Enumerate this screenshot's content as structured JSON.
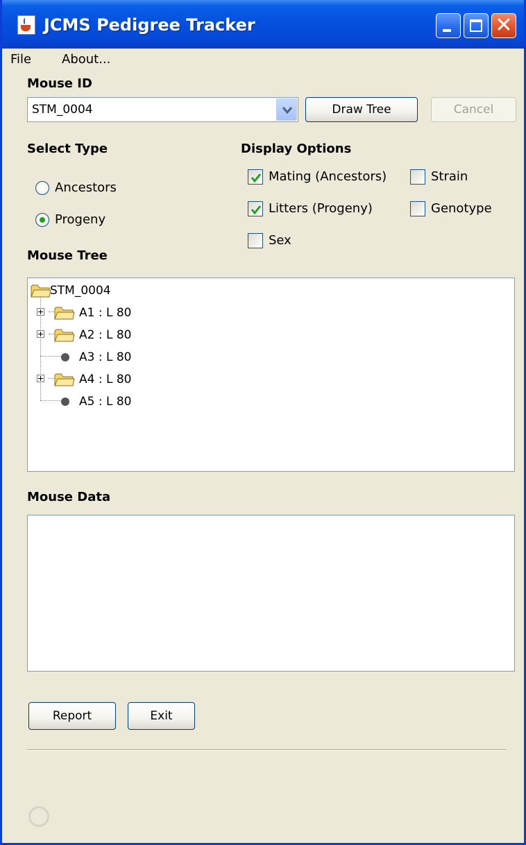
{
  "window": {
    "title": "JCMS Pedigree Tracker",
    "accent": "#0a5fe6"
  },
  "menubar": {
    "items": [
      {
        "label": "File"
      },
      {
        "label": "About..."
      }
    ]
  },
  "mouse_id": {
    "label": "Mouse ID",
    "value": "STM_0004",
    "draw_tree_label": "Draw Tree",
    "cancel_label": "Cancel"
  },
  "select_type": {
    "label": "Select Type",
    "options": [
      {
        "label": "Ancestors",
        "selected": false
      },
      {
        "label": "Progeny",
        "selected": true
      }
    ]
  },
  "display_options": {
    "label": "Display Options",
    "items": [
      {
        "label": "Mating (Ancestors)",
        "checked": true
      },
      {
        "label": "Strain",
        "checked": false
      },
      {
        "label": "Litters (Progeny)",
        "checked": true
      },
      {
        "label": "Genotype",
        "checked": false
      },
      {
        "label": "Sex",
        "checked": false
      }
    ]
  },
  "mouse_tree": {
    "label": "Mouse Tree",
    "root": "STM_0004",
    "nodes": [
      {
        "label": "A1 : L 80",
        "type": "folder",
        "expandable": true
      },
      {
        "label": "A2 : L 80",
        "type": "folder",
        "expandable": true
      },
      {
        "label": "A3 : L 80",
        "type": "leaf",
        "expandable": false
      },
      {
        "label": "A4 : L 80",
        "type": "folder",
        "expandable": true
      },
      {
        "label": "A5 : L 80",
        "type": "leaf",
        "expandable": false
      }
    ]
  },
  "mouse_data": {
    "label": "Mouse Data"
  },
  "footer": {
    "report_label": "Report",
    "exit_label": "Exit"
  }
}
